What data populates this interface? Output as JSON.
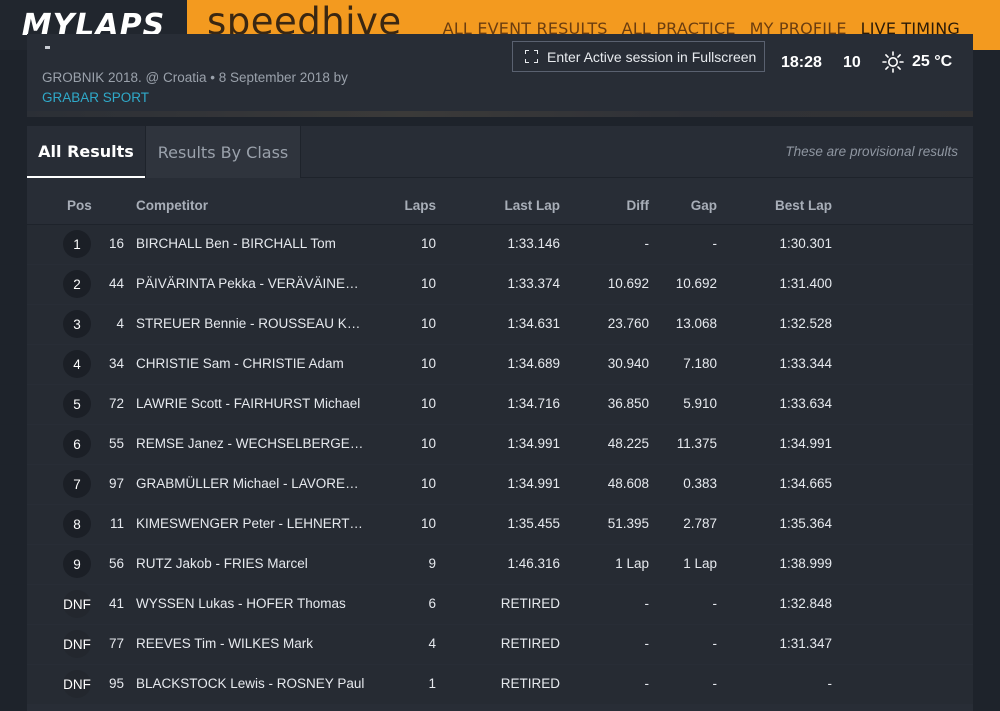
{
  "header": {
    "brand_left": "MYLAPS",
    "brand_right": "speedhive",
    "nav": [
      {
        "label": "ALL EVENT RESULTS",
        "active": false
      },
      {
        "label": "ALL PRACTICE",
        "active": false
      },
      {
        "label": "MY PROFILE",
        "active": false
      },
      {
        "label": "LIVE TIMING",
        "active": true
      }
    ]
  },
  "event": {
    "meta": "GROBNIK 2018. @ Croatia • 8 September 2018 by",
    "organizer": "GRABAR SPORT",
    "fullscreen_label": "Enter Active session in Fullscreen",
    "clock": "18:28",
    "laps": "10",
    "temperature": "25 °C",
    "weather_icon": "sun-icon"
  },
  "results": {
    "tabs": [
      "All Results",
      "Results By Class"
    ],
    "active_tab": "All Results",
    "notice": "These are provisional results",
    "columns": {
      "pos": "Pos",
      "competitor": "Competitor",
      "laps": "Laps",
      "last_lap": "Last Lap",
      "diff": "Diff",
      "gap": "Gap",
      "best_lap": "Best Lap"
    },
    "rows": [
      {
        "pos": "1",
        "num": "16",
        "name": "BIRCHALL Ben - BIRCHALL Tom",
        "laps": "10",
        "last": "1:33.146",
        "diff": "-",
        "gap": "-",
        "best": "1:30.301"
      },
      {
        "pos": "2",
        "num": "44",
        "name": "PÄIVÄRINTA Pekka - VERÄVÄINEN Juha",
        "laps": "10",
        "last": "1:33.374",
        "diff": "10.692",
        "gap": "10.692",
        "best": "1:31.400"
      },
      {
        "pos": "3",
        "num": "4",
        "name": "STREUER Bennie - ROUSSEAU Kevin",
        "laps": "10",
        "last": "1:34.631",
        "diff": "23.760",
        "gap": "13.068",
        "best": "1:32.528"
      },
      {
        "pos": "4",
        "num": "34",
        "name": "CHRISTIE Sam - CHRISTIE Adam",
        "laps": "10",
        "last": "1:34.689",
        "diff": "30.940",
        "gap": "7.180",
        "best": "1:33.344"
      },
      {
        "pos": "5",
        "num": "72",
        "name": "LAWRIE Scott - FAIRHURST Michael",
        "laps": "10",
        "last": "1:34.716",
        "diff": "36.850",
        "gap": "5.910",
        "best": "1:33.634"
      },
      {
        "pos": "6",
        "num": "55",
        "name": "REMSE Janez - WECHSELBERGER Thomas",
        "laps": "10",
        "last": "1:34.991",
        "diff": "48.225",
        "gap": "11.375",
        "best": "1:34.991"
      },
      {
        "pos": "7",
        "num": "97",
        "name": "GRABMÜLLER Michael - LAVORENT Stefan",
        "laps": "10",
        "last": "1:34.991",
        "diff": "48.608",
        "gap": "0.383",
        "best": "1:34.665"
      },
      {
        "pos": "8",
        "num": "11",
        "name": "KIMESWENGER Peter - LEHNERT Thomas",
        "laps": "10",
        "last": "1:35.455",
        "diff": "51.395",
        "gap": "2.787",
        "best": "1:35.364"
      },
      {
        "pos": "9",
        "num": "56",
        "name": "RUTZ Jakob - FRIES Marcel",
        "laps": "9",
        "last": "1:46.316",
        "diff": "1 Lap",
        "gap": "1 Lap",
        "best": "1:38.999"
      },
      {
        "pos": "DNF",
        "num": "41",
        "name": "WYSSEN Lukas - HOFER Thomas",
        "laps": "6",
        "last": "RETIRED",
        "diff": "-",
        "gap": "-",
        "best": "1:32.848"
      },
      {
        "pos": "DNF",
        "num": "77",
        "name": "REEVES Tim - WILKES Mark",
        "laps": "4",
        "last": "RETIRED",
        "diff": "-",
        "gap": "-",
        "best": "1:31.347"
      },
      {
        "pos": "DNF",
        "num": "95",
        "name": "BLACKSTOCK Lewis - ROSNEY Paul",
        "laps": "1",
        "last": "RETIRED",
        "diff": "-",
        "gap": "-",
        "best": "-"
      }
    ]
  },
  "colors": {
    "brand_orange": "#f39a1f",
    "background": "#1e232b",
    "panel": "#282d36",
    "link": "#2fa9c9"
  }
}
